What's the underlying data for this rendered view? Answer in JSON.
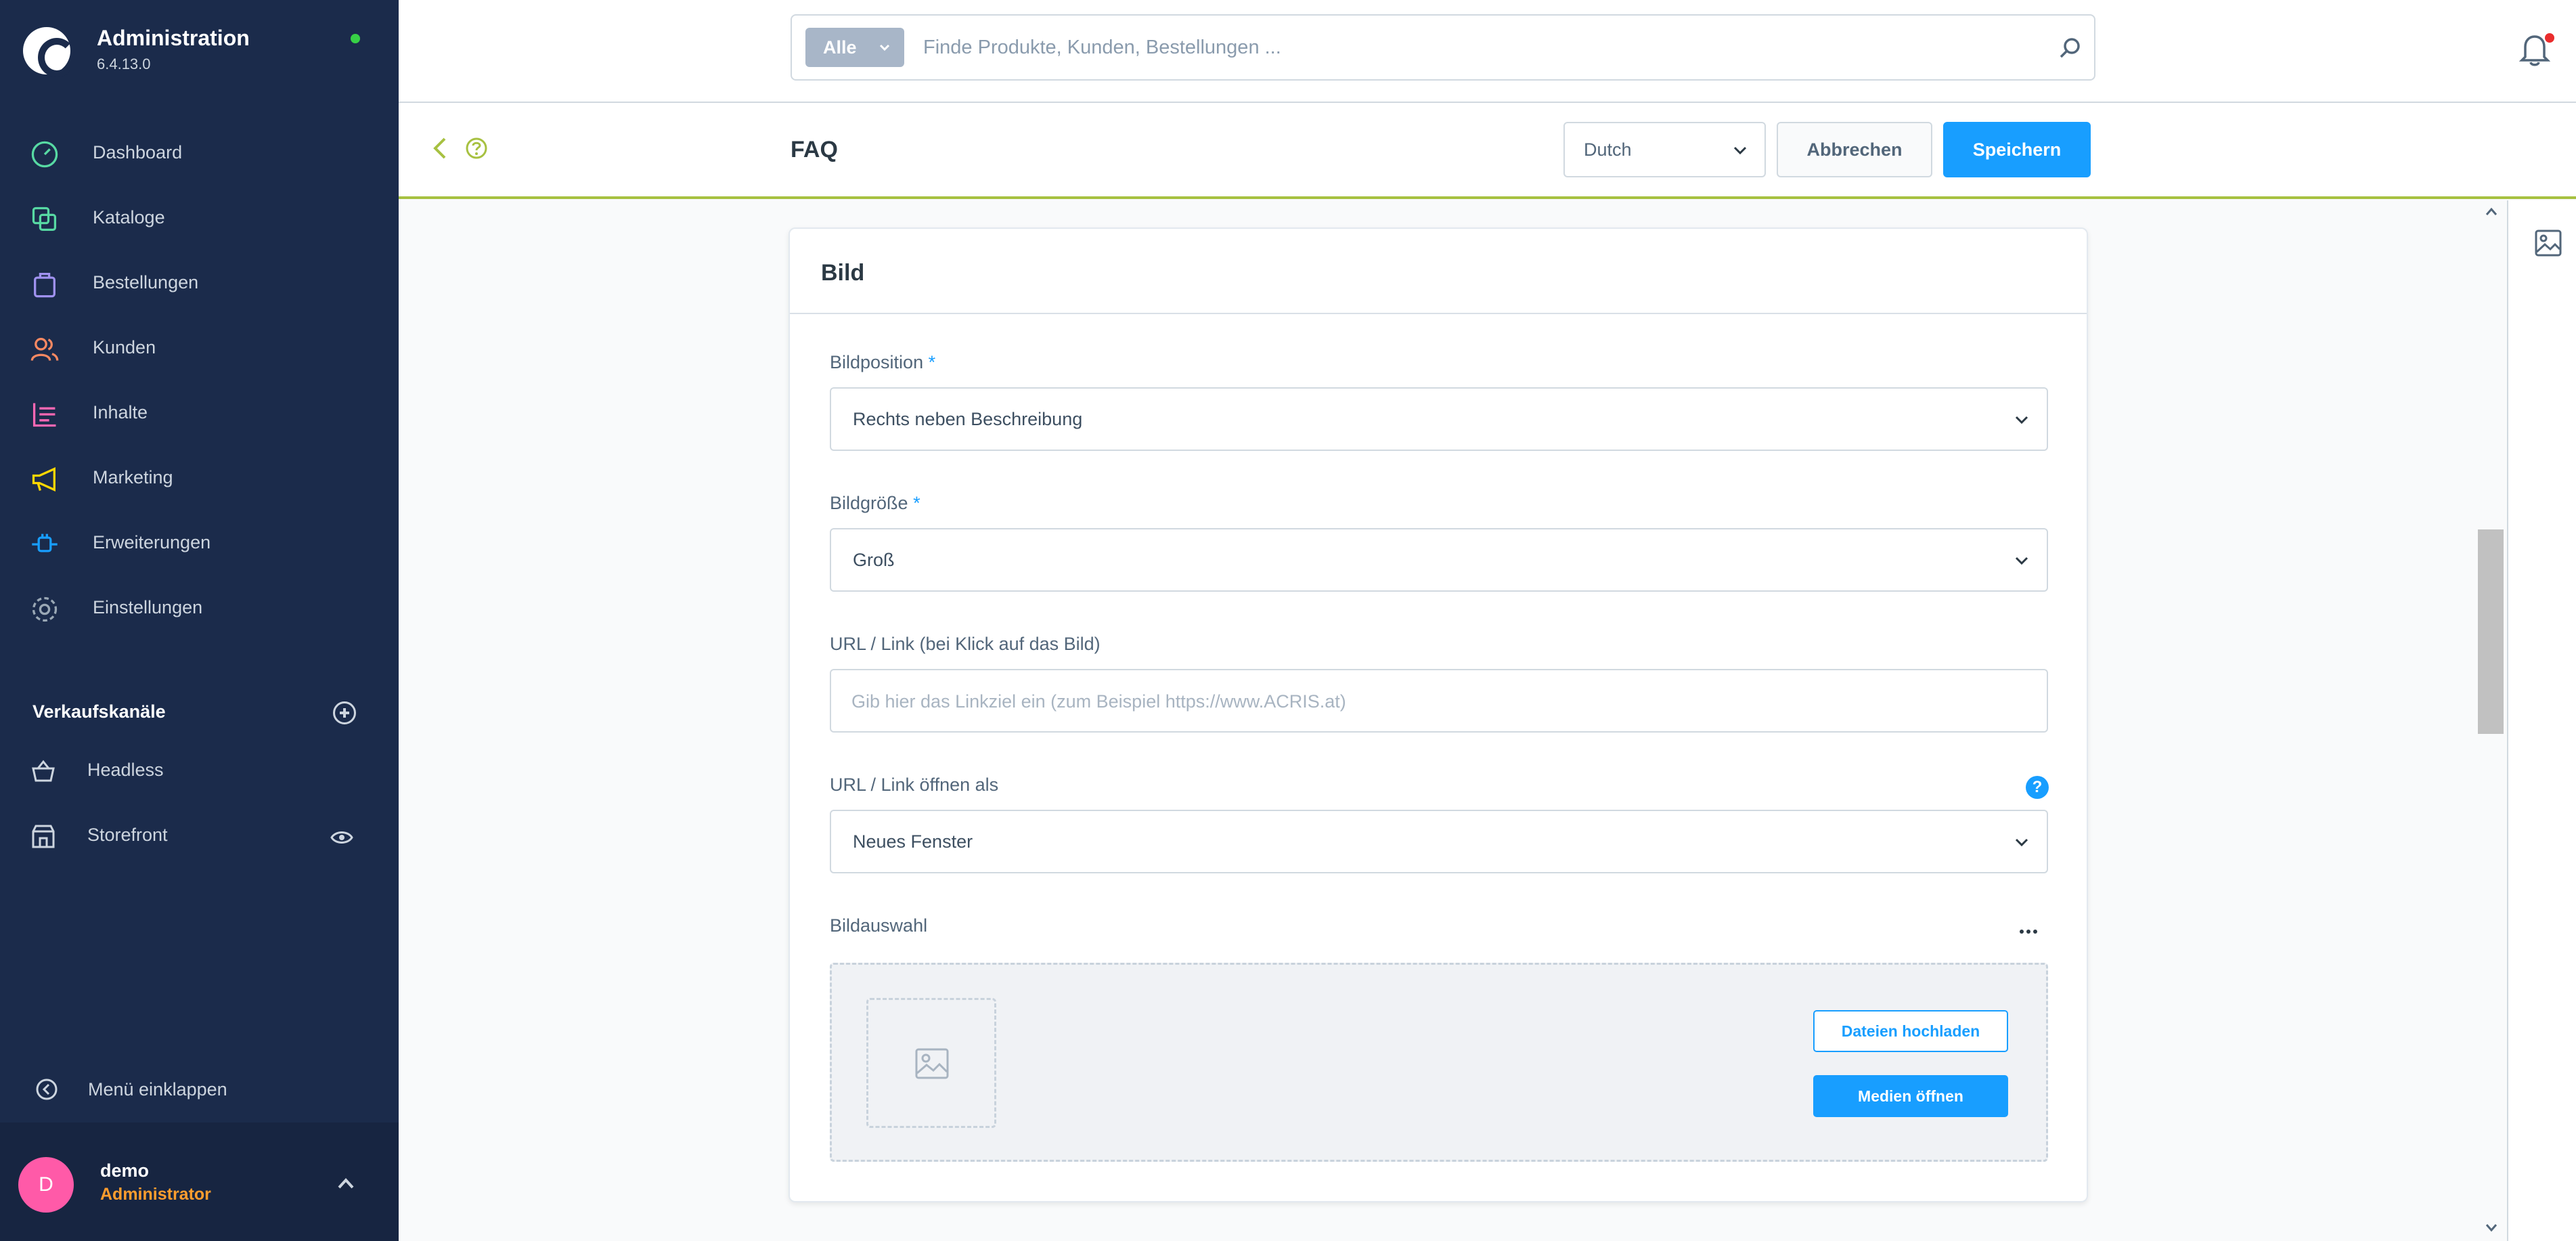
{
  "app": {
    "title": "Administration",
    "version": "6.4.13.0"
  },
  "sidebar": {
    "items": [
      {
        "label": "Dashboard",
        "icon": "dashboard-icon",
        "color": "#57d9a3"
      },
      {
        "label": "Kataloge",
        "icon": "catalog-icon",
        "color": "#57d9a3"
      },
      {
        "label": "Bestellungen",
        "icon": "bag-icon",
        "color": "#a092f0"
      },
      {
        "label": "Kunden",
        "icon": "customers-icon",
        "color": "#f88962"
      },
      {
        "label": "Inhalte",
        "icon": "content-icon",
        "color": "#ff68b4"
      },
      {
        "label": "Marketing",
        "icon": "megaphone-icon",
        "color": "#ffd700"
      },
      {
        "label": "Erweiterungen",
        "icon": "plug-icon",
        "color": "#189eff"
      },
      {
        "label": "Einstellungen",
        "icon": "gear-icon",
        "color": "#9aa8b5"
      }
    ],
    "sales_channels_title": "Verkaufskanäle",
    "channels": [
      {
        "label": "Headless"
      },
      {
        "label": "Storefront"
      }
    ],
    "collapse_label": "Menü einklappen",
    "user": {
      "initial": "D",
      "name": "demo",
      "role": "Administrator"
    }
  },
  "search": {
    "type_label": "Alle",
    "placeholder": "Finde Produkte, Kunden, Bestellungen ..."
  },
  "smartbar": {
    "title": "FAQ",
    "language": "Dutch",
    "cancel_label": "Abbrechen",
    "save_label": "Speichern"
  },
  "card": {
    "title": "Bild",
    "fields": {
      "position_label": "Bildposition",
      "position_value": "Rechts neben Beschreibung",
      "size_label": "Bildgröße",
      "size_value": "Groß",
      "required_mark": "*",
      "url_label": "URL / Link (bei Klick auf das Bild)",
      "url_placeholder": "Gib hier das Linkziel ein (zum Beispiel https://www.ACRIS.at)",
      "open_label": "URL / Link öffnen als",
      "open_value": "Neues Fenster",
      "help_glyph": "?",
      "image_label": "Bildauswahl",
      "upload_label": "Dateien hochladen",
      "media_label": "Medien öffnen"
    }
  },
  "colors": {
    "sidebar_bg": "#1b2b4b",
    "primary": "#189eff",
    "smartbar_accent": "#a7c141",
    "online": "#37d046",
    "avatar": "#ff5aa8",
    "role": "#ff9d2e",
    "notification": "#ea2d2d"
  }
}
